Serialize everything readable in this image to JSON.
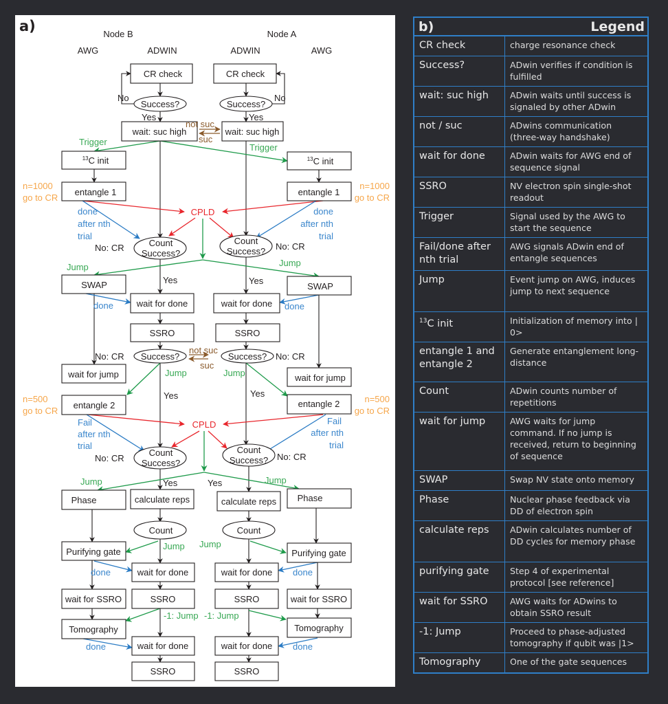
{
  "panel_a": {
    "label": "a)",
    "headers": {
      "node_b": "Node B",
      "node_a": "Node A",
      "awg_b": "AWG",
      "adwin_b": "ADWIN",
      "adwin_a": "ADWIN",
      "awg_a": "AWG"
    },
    "nodes": {
      "cr_check": "CR check",
      "success": "Success?",
      "wait_suc_high": "wait: suc high",
      "c13_init_sup": "13",
      "c13_init": "C init",
      "entangle1": "entangle 1",
      "entangle2": "entangle 2",
      "count": "Count",
      "success2": "Success?",
      "swap": "SWAP",
      "wait_for_done": "wait for done",
      "ssro": "SSRO",
      "wait_for_jump": "wait for jump",
      "phase": "Phase",
      "calculate_reps": "calculate reps",
      "purifying_gate": "Purifying gate",
      "wait_for_ssro": "wait for SSRO",
      "tomography": "Tomography",
      "cpld": "CPLD"
    },
    "edge_labels": {
      "no": "No",
      "yes": "Yes",
      "not_suc": "not suc",
      "suc": "suc",
      "trigger": "Trigger",
      "n1000": "n=1000",
      "n500": "n=500",
      "go_to_cr": "go to CR",
      "done": "done",
      "fail": "Fail",
      "after_nth": "after nth",
      "trial": "trial",
      "no_cr": "No: CR",
      "jump": "Jump",
      "minus1_jump": "-1: Jump"
    }
  },
  "legend": {
    "label": "b)",
    "title": "Legend",
    "rows": [
      {
        "term": "CR check",
        "desc": "charge resonance check"
      },
      {
        "term": "Success?",
        "desc": "ADwin verifies if condition is fulfilled"
      },
      {
        "term": "wait: suc high",
        "desc": "ADwin waits until success is signaled by other ADwin"
      },
      {
        "term": "not / suc",
        "desc": "ADwins communication (three-way handshake)"
      },
      {
        "term": "wait for done",
        "desc": "ADwin waits for AWG end of sequence signal"
      },
      {
        "term": "SSRO",
        "desc": "NV electron spin single-shot readout"
      },
      {
        "term": "Trigger",
        "desc": "Signal used by the AWG to start the sequence"
      },
      {
        "term": "Fail/done after nth trial",
        "desc": "AWG signals ADwin end of entangle sequences"
      },
      {
        "term": "Jump",
        "desc": "Event jump on AWG, induces jump to next sequence"
      },
      {
        "term_sup": "13",
        "term": "C init",
        "desc": "Initialization of memory into | 0>"
      },
      {
        "term": "entangle 1 and entangle 2",
        "desc": "Generate entanglement long-distance"
      },
      {
        "term": "Count",
        "desc": "ADwin counts number of repetitions"
      },
      {
        "term": "wait for jump",
        "desc": "AWG waits for jump command. If no jump is received, return to beginning of sequence"
      },
      {
        "term": "SWAP",
        "desc": "Swap NV state onto memory"
      },
      {
        "term": "Phase",
        "desc": "Nuclear phase feedback via DD of electron spin"
      },
      {
        "term": "calculate reps",
        "desc": "ADwin calculates number of DD cycles for memory phase"
      },
      {
        "term": "purifying gate",
        "desc": "Step 4 of experimental protocol [see reference]"
      },
      {
        "term": "wait for SSRO",
        "desc": "AWG waits for ADwins to obtain SSRO result"
      },
      {
        "term": "-1: Jump",
        "desc": "Proceed to phase-adjusted tomography if qubit was |1>"
      },
      {
        "term": "Tomography",
        "desc": "One of the gate sequences"
      }
    ]
  }
}
